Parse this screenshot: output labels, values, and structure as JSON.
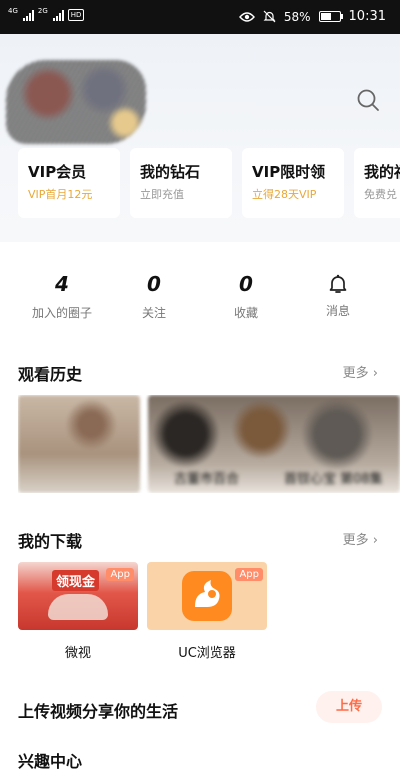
{
  "status_bar": {
    "signal1_label": "4G",
    "signal2_label": "2G",
    "network_badge": "HD",
    "battery": "58%",
    "time": "10:31",
    "battery_level": 0.58
  },
  "header": {
    "search_icon": "search-icon"
  },
  "vip_cards": [
    {
      "title": "VIP会员",
      "subtitle": "VIP首月12元",
      "subtitle_color": "#e8a83a"
    },
    {
      "title": "我的钻石",
      "subtitle": "立即充值",
      "subtitle_color": "#999999"
    },
    {
      "title": "VIP限时领",
      "subtitle": "立得28天VIP",
      "subtitle_color": "#e8a83a"
    },
    {
      "title": "我的福",
      "subtitle": "免费兑",
      "subtitle_color": "#999999"
    }
  ],
  "stats": [
    {
      "value": "4",
      "label": "加入的圈子"
    },
    {
      "value": "0",
      "label": "关注"
    },
    {
      "value": "0",
      "label": "收藏"
    },
    {
      "value": "",
      "label": "消息",
      "icon": "bell-icon"
    }
  ],
  "history": {
    "title": "观看历史",
    "more": "更多 ›",
    "items": [
      {
        "caption": "古董市百合"
      },
      {
        "caption": "首钗心宝 第08集"
      }
    ]
  },
  "downloads": {
    "title": "我的下载",
    "more": "更多 ›",
    "items": [
      {
        "label": "微视",
        "badge": "App",
        "thumb_text": "领现金"
      },
      {
        "label": "UC浏览器",
        "badge": "App"
      }
    ]
  },
  "upload": {
    "title": "上传视频分享你的生活",
    "button": "上传"
  },
  "next_section": {
    "title": "兴趣中心"
  }
}
